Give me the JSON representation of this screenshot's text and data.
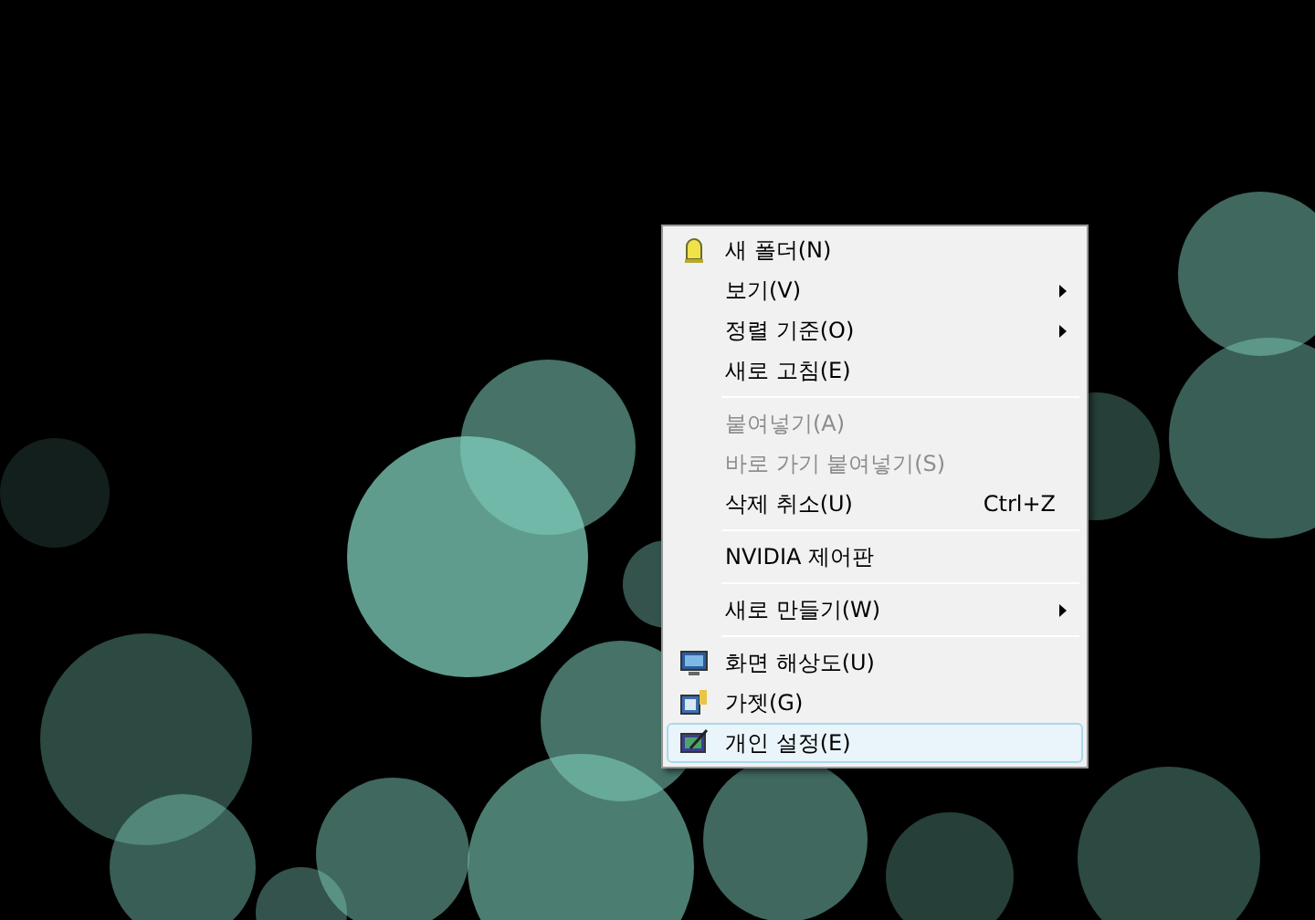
{
  "context_menu": {
    "groups": [
      [
        {
          "kind": "folder-item",
          "label": "새 폴더(N)",
          "has_submenu": false,
          "disabled": false,
          "selected": false
        },
        {
          "kind": "plain",
          "label": "보기(V)",
          "has_submenu": true,
          "disabled": false,
          "selected": false
        },
        {
          "kind": "plain",
          "label": "정렬 기준(O)",
          "has_submenu": true,
          "disabled": false,
          "selected": false
        },
        {
          "kind": "plain",
          "label": "새로 고침(E)",
          "has_submenu": false,
          "disabled": false,
          "selected": false
        }
      ],
      [
        {
          "kind": "plain",
          "label": "붙여넣기(A)",
          "has_submenu": false,
          "disabled": true,
          "selected": false
        },
        {
          "kind": "plain",
          "label": "바로 가기 붙여넣기(S)",
          "has_submenu": false,
          "disabled": true,
          "selected": false
        },
        {
          "kind": "plain",
          "label": "삭제 취소(U)",
          "shortcut": "Ctrl+Z",
          "has_submenu": false,
          "disabled": false,
          "selected": false
        }
      ],
      [
        {
          "kind": "plain",
          "label": "NVIDIA 제어판",
          "has_submenu": false,
          "disabled": false,
          "selected": false
        }
      ],
      [
        {
          "kind": "plain",
          "label": "새로 만들기(W)",
          "has_submenu": true,
          "disabled": false,
          "selected": false
        }
      ],
      [
        {
          "kind": "display-item",
          "label": "화면 해상도(U)",
          "has_submenu": false,
          "disabled": false,
          "selected": false
        },
        {
          "kind": "gadget-item",
          "label": "가젯(G)",
          "has_submenu": false,
          "disabled": false,
          "selected": false
        },
        {
          "kind": "personalize-item",
          "label": "개인 설정(E)",
          "has_submenu": false,
          "disabled": false,
          "selected": true
        }
      ]
    ]
  }
}
